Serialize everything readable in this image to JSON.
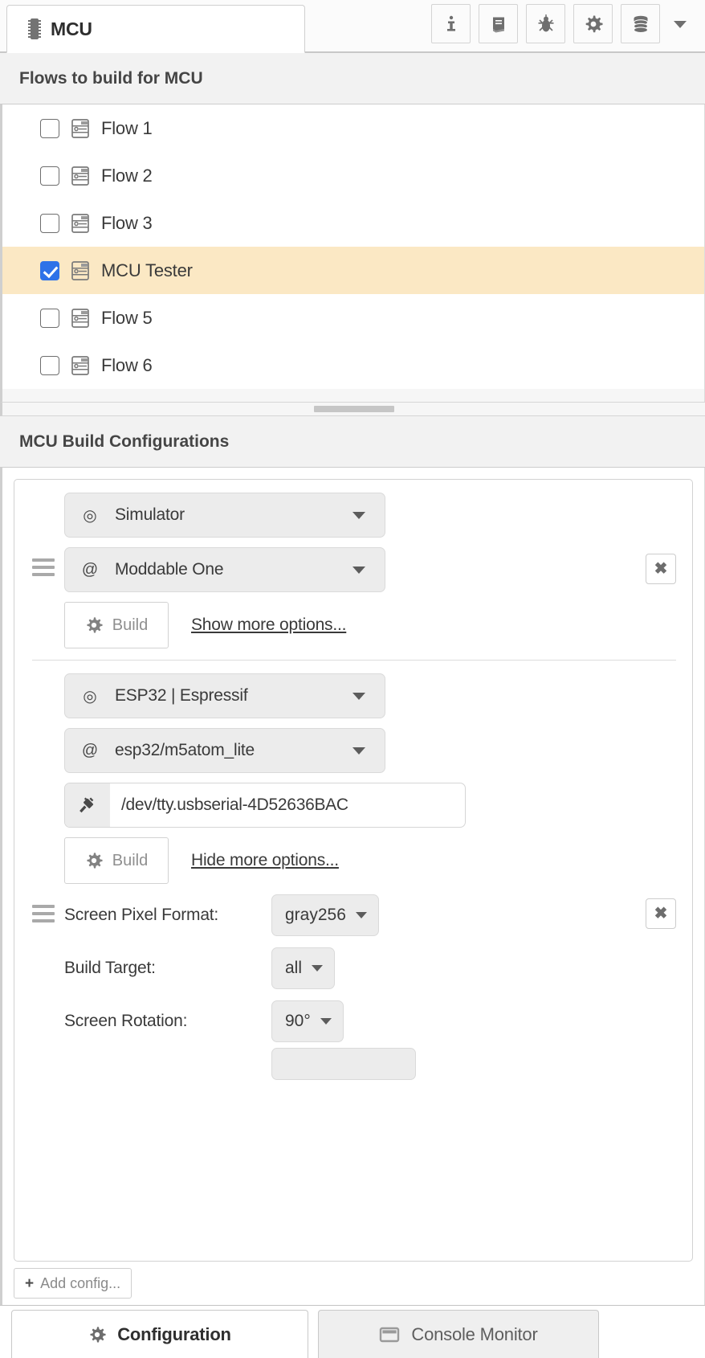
{
  "window": {
    "doc_tab": {
      "title": "MCU",
      "icon": "chip-icon"
    },
    "toolbar": [
      {
        "name": "info-button",
        "icon": "info-icon",
        "glyph": "i"
      },
      {
        "name": "documentation-button",
        "icon": "book-icon",
        "glyph": "book"
      },
      {
        "name": "debug-button",
        "icon": "bug-icon",
        "glyph": "bug"
      },
      {
        "name": "settings-button",
        "icon": "gear-icon",
        "glyph": "gear"
      },
      {
        "name": "database-button",
        "icon": "database-icon",
        "glyph": "database"
      }
    ],
    "toolbar_overflow": {
      "name": "toolbar-overflow-button",
      "icon": "chevron-down-icon"
    }
  },
  "flows_section": {
    "header": "Flows to build for MCU",
    "items": [
      {
        "label": "Flow 1",
        "checked": false
      },
      {
        "label": "Flow 2",
        "checked": false
      },
      {
        "label": "Flow 3",
        "checked": false
      },
      {
        "label": "MCU Tester",
        "checked": true
      },
      {
        "label": "Flow 5",
        "checked": false
      },
      {
        "label": "Flow 6",
        "checked": false
      }
    ],
    "selected_highlight_color": "#fbe8c4",
    "checkbox_accent_color": "#2f72e8"
  },
  "build_section": {
    "header": "MCU Build Configurations",
    "configs": [
      {
        "platform": {
          "label": "Simulator",
          "glyph": "◎"
        },
        "device": {
          "label": "Moddable One",
          "glyph": "@"
        },
        "build_label": "Build",
        "options_link": "Show more options...",
        "close_label": "✖"
      },
      {
        "platform": {
          "label": "ESP32 | Espressif",
          "glyph": "◎"
        },
        "device": {
          "label": "esp32/m5atom_lite",
          "glyph": "@"
        },
        "port": {
          "value": "/dev/tty.usbserial-4D52636BAC",
          "icon": "plug-icon"
        },
        "build_label": "Build",
        "options_link": "Hide more options...",
        "close_label": "✖",
        "extra_options": [
          {
            "label": "Screen Pixel Format:",
            "value": "gray256"
          },
          {
            "label": "Build Target:",
            "value": "all"
          },
          {
            "label": "Screen Rotation:",
            "value": "90°"
          }
        ]
      }
    ],
    "add_config_label": "Add config...",
    "add_config_plus": "+"
  },
  "bottom_tabs": [
    {
      "label": "Configuration",
      "icon": "gear-icon",
      "active": true
    },
    {
      "label": "Console Monitor",
      "icon": "window-icon",
      "active": false
    }
  ]
}
